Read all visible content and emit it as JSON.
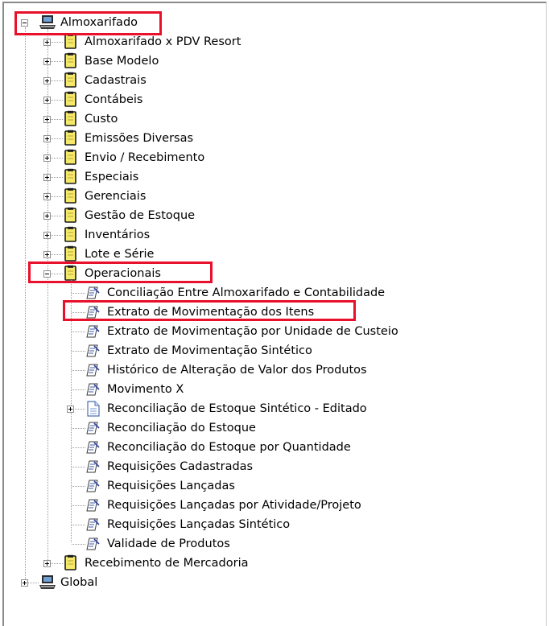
{
  "tree": {
    "root1": {
      "label": "Almoxarifado",
      "expanded": true
    },
    "groups": [
      {
        "label": "Almoxarifado x PDV Resort"
      },
      {
        "label": "Base Modelo"
      },
      {
        "label": "Cadastrais"
      },
      {
        "label": "Contábeis"
      },
      {
        "label": "Custo"
      },
      {
        "label": "Emissões Diversas"
      },
      {
        "label": "Envio / Recebimento"
      },
      {
        "label": "Especiais"
      },
      {
        "label": "Gerenciais"
      },
      {
        "label": "Gestão de Estoque"
      },
      {
        "label": "Inventários"
      },
      {
        "label": "Lote e Série"
      }
    ],
    "operacionais": {
      "label": "Operacionais",
      "expanded": true,
      "items": [
        {
          "label": "Conciliação Entre Almoxarifado e Contabilidade",
          "icon": "report-icon"
        },
        {
          "label": "Extrato de Movimentação dos Itens",
          "icon": "report-icon",
          "selected": true
        },
        {
          "label": "Extrato de Movimentação por Unidade de Custeio",
          "icon": "report-icon"
        },
        {
          "label": "Extrato de Movimentação Sintético",
          "icon": "report-icon"
        },
        {
          "label": "Histórico de Alteração de Valor dos Produtos",
          "icon": "report-icon"
        },
        {
          "label": "Movimento X",
          "icon": "report-icon"
        },
        {
          "label": "Reconciliação de Estoque Sintético - Editado",
          "icon": "document-icon",
          "expandable": true
        },
        {
          "label": "Reconciliação do Estoque",
          "icon": "report-icon"
        },
        {
          "label": "Reconciliação do Estoque por Quantidade",
          "icon": "report-icon"
        },
        {
          "label": "Requisições Cadastradas",
          "icon": "report-icon"
        },
        {
          "label": "Requisições Lançadas",
          "icon": "report-icon"
        },
        {
          "label": "Requisições Lançadas por Atividade/Projeto",
          "icon": "report-icon"
        },
        {
          "label": "Requisições Lançadas Sintético",
          "icon": "report-icon"
        },
        {
          "label": "Validade de Produtos",
          "icon": "report-icon"
        }
      ]
    },
    "after_groups": [
      {
        "label": "Recebimento de Mercadoria"
      }
    ],
    "root2": {
      "label": "Global",
      "expanded": false
    }
  },
  "colors": {
    "highlight": "#e8102a",
    "folder_fill": "#f5e96a",
    "line": "#9a9a9a"
  }
}
